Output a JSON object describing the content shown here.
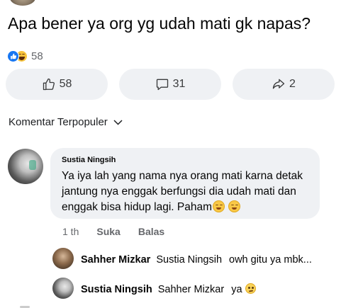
{
  "post": {
    "text": "Apa bener ya org yg udah mati gk napas?",
    "reaction_count": "58"
  },
  "actions": {
    "like_count": "58",
    "comment_count": "31",
    "share_count": "2"
  },
  "comments_header": {
    "sort_label": "Komentar Terpopuler"
  },
  "top_comment": {
    "author": "Sustia Ningsih",
    "text": "Ya iya lah yang nama nya orang mati karna detak jantung nya enggak berfungsi dia udah mati dan enggak bisa hidup lagi. Paham",
    "time": "1 th",
    "like_label": "Suka",
    "reply_label": "Balas"
  },
  "replies": [
    {
      "author": "Sahher Mizkar",
      "mention": "Sustia Ningsih",
      "text": "owh gitu ya mbk..."
    },
    {
      "author": "Sustia Ningsih",
      "mention": "Sahher Mizkar",
      "text": "ya"
    }
  ],
  "colors": {
    "accent": "#1877f2",
    "bubble_bg": "#eff1f4",
    "muted_text": "#65676b"
  },
  "icons": {
    "like": "thumbs-up-icon",
    "comment": "speech-bubble-icon",
    "share": "share-arrow-icon",
    "sort": "chevron-down-icon"
  }
}
